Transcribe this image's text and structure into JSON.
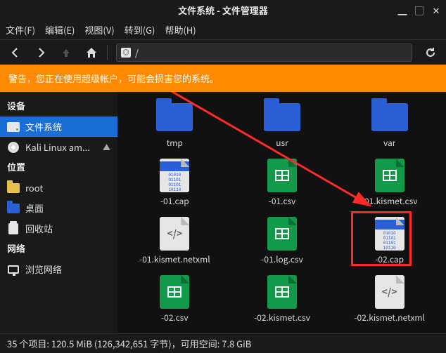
{
  "window": {
    "title": "文件系统 - 文件管理器"
  },
  "menu": {
    "file": "文件(F)",
    "edit": "编辑(E)",
    "view": "视图(V)",
    "go": "转到(G)",
    "help": "帮助(H)"
  },
  "path": {
    "text": "/"
  },
  "warning": "警告，您正在使用超级帐户，可能会损害您的系统。",
  "sidebar": {
    "devices_head": "设备",
    "devices": [
      {
        "label": "文件系统",
        "icon": "drive",
        "selected": true
      },
      {
        "label": "Kali Linux am...",
        "icon": "disc",
        "eject": true
      }
    ],
    "places_head": "位置",
    "places": [
      {
        "label": "root",
        "icon": "folder-y"
      },
      {
        "label": "桌面",
        "icon": "folder-b"
      },
      {
        "label": "回收站",
        "icon": "trash"
      }
    ],
    "network_head": "网络",
    "network": [
      {
        "label": "浏览网络",
        "icon": "net"
      }
    ]
  },
  "files": [
    {
      "name": "tmp",
      "type": "folder"
    },
    {
      "name": "usr",
      "type": "folder"
    },
    {
      "name": "var",
      "type": "folder"
    },
    {
      "name": "-01.cap",
      "type": "cap"
    },
    {
      "name": "-01.csv",
      "type": "sheet"
    },
    {
      "name": "-01.kismet.csv",
      "type": "sheet"
    },
    {
      "name": "-01.kismet.netxml",
      "type": "code"
    },
    {
      "name": "-01.log.csv",
      "type": "sheet"
    },
    {
      "name": "-02.cap",
      "type": "cap",
      "highlighted": true
    },
    {
      "name": "-02.csv",
      "type": "sheet"
    },
    {
      "name": "-02.kismet.csv",
      "type": "sheet"
    },
    {
      "name": "-02.kismet.netxml",
      "type": "code"
    }
  ],
  "status": "35 个项目: 120.5 MiB (126,342,651 字节)，可用空间: 7.8 GiB",
  "cap_bits": "01010\n01101\n01101\n10110"
}
